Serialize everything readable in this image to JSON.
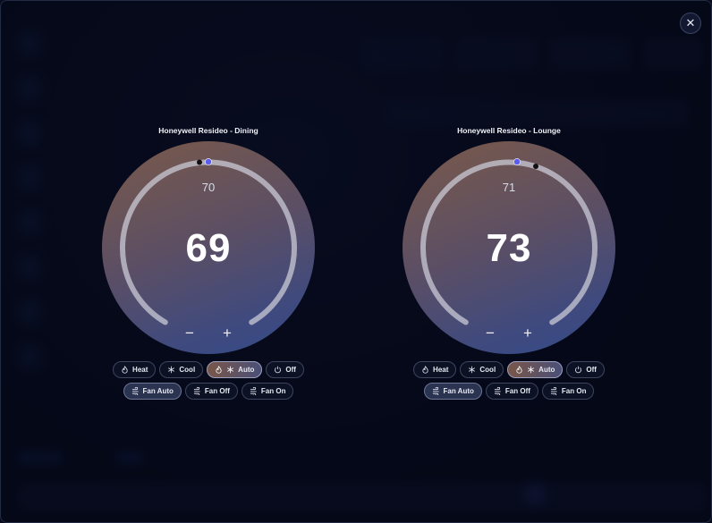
{
  "close_label": "✕",
  "thermostats": [
    {
      "name": "Honeywell Resideo - Dining",
      "setpoint": "70",
      "current": "69",
      "setpoint_fraction": 0.5,
      "minus_label": "−",
      "plus_label": "+",
      "modes": [
        {
          "label": "Heat",
          "icon": "flame-icon",
          "active": false
        },
        {
          "label": "Cool",
          "icon": "snowflake-icon",
          "active": false
        },
        {
          "label": "Auto",
          "icon": "flame-snowflake-icon",
          "active": true
        },
        {
          "label": "Off",
          "icon": "power-icon",
          "active": false
        }
      ],
      "fan_modes": [
        {
          "label": "Fan Auto",
          "icon": "fan-icon",
          "active": true
        },
        {
          "label": "Fan Off",
          "icon": "fan-icon",
          "active": false
        },
        {
          "label": "Fan On",
          "icon": "fan-icon",
          "active": false
        }
      ]
    },
    {
      "name": "Honeywell Resideo - Lounge",
      "setpoint": "71",
      "current": "73",
      "setpoint_fraction": 0.5,
      "minus_label": "−",
      "plus_label": "+",
      "modes": [
        {
          "label": "Heat",
          "icon": "flame-icon",
          "active": false
        },
        {
          "label": "Cool",
          "icon": "snowflake-icon",
          "active": false
        },
        {
          "label": "Auto",
          "icon": "flame-snowflake-icon",
          "active": true
        },
        {
          "label": "Off",
          "icon": "power-icon",
          "active": false
        }
      ],
      "fan_modes": [
        {
          "label": "Fan Auto",
          "icon": "fan-icon",
          "active": true
        },
        {
          "label": "Fan Off",
          "icon": "fan-icon",
          "active": false
        },
        {
          "label": "Fan On",
          "icon": "fan-icon",
          "active": false
        }
      ]
    }
  ],
  "colors": {
    "setpoint_dot": "#5b5cf0",
    "current_dot": "#111111",
    "ring": "#c9c9d6"
  }
}
